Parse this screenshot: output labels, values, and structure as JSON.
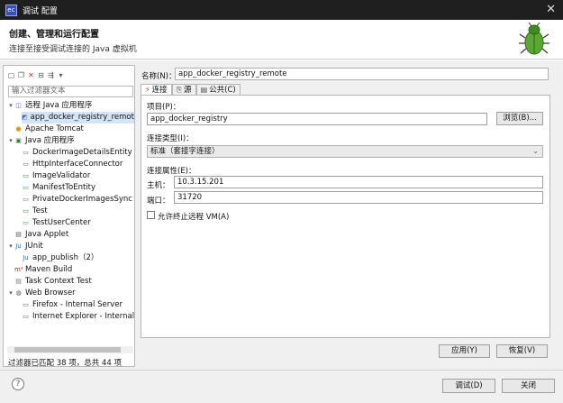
{
  "window": {
    "title": "调试 配置",
    "icon": "eclipse-app-icon",
    "close": "✕"
  },
  "header": {
    "title": "创建、管理和运行配置",
    "subtitle": "连接至接受调试连接的 Java 虚拟机",
    "icon": "debug-bug-icon"
  },
  "toolbar": {
    "icons": [
      "new-config-icon",
      "duplicate-icon",
      "delete-icon",
      "collapse-icon",
      "filter-icon",
      "dropdown-icon"
    ]
  },
  "left": {
    "filter_placeholder": "输入过滤器文本",
    "status": "过滤器已匹配 38 项，总共 44 项",
    "tree": [
      {
        "label": "远程 Java 应用程序",
        "level": 0,
        "expanded": true,
        "icon": "remote-java-icon"
      },
      {
        "label": "app_docker_registry_remote",
        "level": 1,
        "selected": true,
        "icon": "remote-java-config-icon"
      },
      {
        "label": "Apache Tomcat",
        "level": 0,
        "icon": "tomcat-icon"
      },
      {
        "label": "Java 应用程序",
        "level": 0,
        "expanded": true,
        "icon": "java-app-icon"
      },
      {
        "label": "DockerImageDetailsEntity",
        "level": 1,
        "icon": "java-class-icon"
      },
      {
        "label": "HttpInterfaceConnector",
        "level": 1,
        "icon": "java-class-icon"
      },
      {
        "label": "ImageValidator",
        "level": 1,
        "icon": "java-class-icon"
      },
      {
        "label": "ManifestToEntity",
        "level": 1,
        "icon": "java-class-icon"
      },
      {
        "label": "PrivateDockerImagesSync",
        "level": 1,
        "icon": "java-class-icon"
      },
      {
        "label": "Test",
        "level": 1,
        "icon": "java-class-icon"
      },
      {
        "label": "TestUserCenter",
        "level": 1,
        "icon": "java-class-icon"
      },
      {
        "label": "Java Applet",
        "level": 0,
        "icon": "applet-icon"
      },
      {
        "label": "JUnit",
        "level": 0,
        "expanded": true,
        "icon": "junit-icon"
      },
      {
        "label": "app_publish（2）",
        "level": 1,
        "icon": "junit-config-icon"
      },
      {
        "label": "Maven Build",
        "level": 0,
        "icon": "maven-icon"
      },
      {
        "label": "Task Context Test",
        "level": 0,
        "icon": "task-icon"
      },
      {
        "label": "Web Browser",
        "level": 0,
        "expanded": true,
        "icon": "web-browser-icon"
      },
      {
        "label": "Firefox - Internal Server",
        "level": 1,
        "icon": "browser-config-icon"
      },
      {
        "label": "Internet Explorer - Internal",
        "level": 1,
        "icon": "browser-config-icon"
      }
    ]
  },
  "right": {
    "name_label": "名称(N)：",
    "name_value": "app_docker_registry_remote",
    "tabs": [
      {
        "label": "连接",
        "icon": "connect-tab-icon",
        "active": true
      },
      {
        "label": "源",
        "icon": "source-tab-icon"
      },
      {
        "label": "公共(C)",
        "icon": "common-tab-icon"
      }
    ],
    "project_label": "项目(P)：",
    "project_value": "app_docker_registry",
    "browse_button": "浏览(B)...",
    "connection_type_label": "连接类型(I)：",
    "connection_type_value": "标准（套接字连接）",
    "connection_props_label": "连接属性(E)：",
    "host_label": "主机：",
    "host_value": "10.3.15.201",
    "port_label": "端口：",
    "port_value": "31720",
    "allow_terminate_label": "允许终止远程 VM(A)",
    "allow_terminate_checked": false,
    "apply_button": "应用(Y)",
    "revert_button": "恢复(V)"
  },
  "footer": {
    "help": "?",
    "debug_button": "调试(D)",
    "close_button": "关闭"
  }
}
